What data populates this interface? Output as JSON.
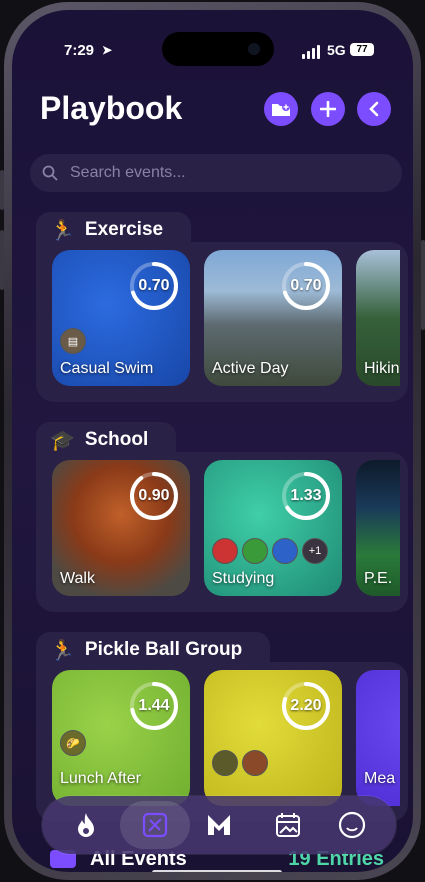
{
  "status": {
    "time": "7:29",
    "network": "5G",
    "battery": "77"
  },
  "header": {
    "title": "Playbook"
  },
  "search": {
    "placeholder": "Search events..."
  },
  "sections": [
    {
      "title": "Exercise",
      "icon": "runner-icon",
      "cards": [
        {
          "label": "Casual Swim",
          "score": "0.70",
          "progress": 0.7
        },
        {
          "label": "Active Day",
          "score": "0.70",
          "progress": 0.7
        },
        {
          "label": "Hikin",
          "score": "",
          "progress": 0
        }
      ]
    },
    {
      "title": "School",
      "icon": "graduation-cap-icon",
      "cards": [
        {
          "label": "Walk",
          "score": "0.90",
          "progress": 0.9
        },
        {
          "label": "Studying",
          "score": "1.33",
          "progress": 0.66,
          "more": "+1"
        },
        {
          "label": "P.E.",
          "score": "",
          "progress": 0
        }
      ]
    },
    {
      "title": "Pickle Ball Group",
      "icon": "runner-icon",
      "cards": [
        {
          "label": "Lunch After",
          "score": "1.44",
          "progress": 0.72
        },
        {
          "label": "",
          "score": "2.20",
          "progress": 0.8
        },
        {
          "label": "Mea",
          "score": "",
          "progress": 0
        }
      ]
    }
  ],
  "nav": {
    "items": [
      "flame-icon",
      "map-icon",
      "m-icon",
      "calendar-photo-icon",
      "circle-icon"
    ]
  },
  "footer": {
    "all_events": "All Events",
    "entries": "19 Entries"
  },
  "colors": {
    "accent": "#7c4dff",
    "entries": "#4ed6a8"
  }
}
